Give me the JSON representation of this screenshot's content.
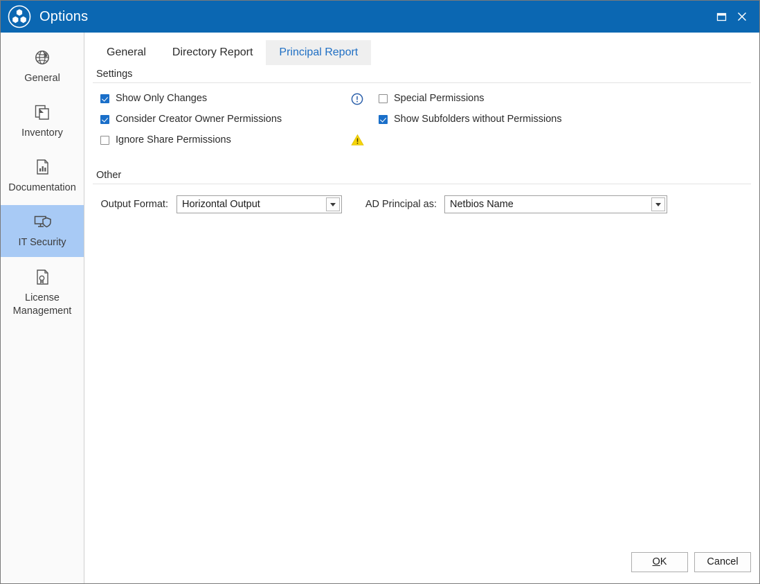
{
  "window": {
    "title": "Options",
    "logo_icon": "three-hexagon-logo-icon",
    "restore_icon": "restore-window-icon",
    "close_icon": "close-window-icon",
    "accent_color": "#0b67b2"
  },
  "sidebar": {
    "items": [
      {
        "label": "General",
        "icon": "globe-icon",
        "selected": false
      },
      {
        "label": "Inventory",
        "icon": "documents-stack-icon",
        "selected": false
      },
      {
        "label": "Documentation",
        "icon": "chart-document-icon",
        "selected": false
      },
      {
        "label": "IT Security",
        "icon": "monitor-shield-icon",
        "selected": true
      },
      {
        "label": "License Management",
        "icon": "certificate-document-icon",
        "selected": false
      }
    ],
    "selected_color": "#a8caf5"
  },
  "tabs": [
    {
      "label": "General",
      "active": false
    },
    {
      "label": "Directory Report",
      "active": false
    },
    {
      "label": "Principal Report",
      "active": true
    }
  ],
  "settings": {
    "header": "Settings",
    "checkboxes_left": [
      {
        "label": "Show Only Changes",
        "checked": true
      },
      {
        "label": "Consider Creator Owner Permissions",
        "checked": true
      },
      {
        "label": "Ignore Share Permissions",
        "checked": false
      }
    ],
    "badges": [
      {
        "icon": "info-circle-icon",
        "color": "#2a5faa"
      },
      {
        "icon": "none",
        "color": ""
      },
      {
        "icon": "warning-triangle-icon",
        "color": "#f5d40a"
      }
    ],
    "checkboxes_right": [
      {
        "label": "Special Permissions",
        "checked": false
      },
      {
        "label": "Show Subfolders without Permissions",
        "checked": true
      },
      {
        "label": "",
        "checked": null
      }
    ]
  },
  "other": {
    "header": "Other",
    "output_format": {
      "label": "Output Format:",
      "value": "Horizontal Output",
      "arrow_icon": "chevron-down-icon"
    },
    "ad_principal": {
      "label": "AD Principal as:",
      "value": "Netbios Name",
      "arrow_icon": "chevron-down-icon"
    }
  },
  "footer": {
    "ok_accel": "O",
    "ok_rest": "K",
    "ok_label": "OK",
    "cancel_label": "Cancel"
  }
}
